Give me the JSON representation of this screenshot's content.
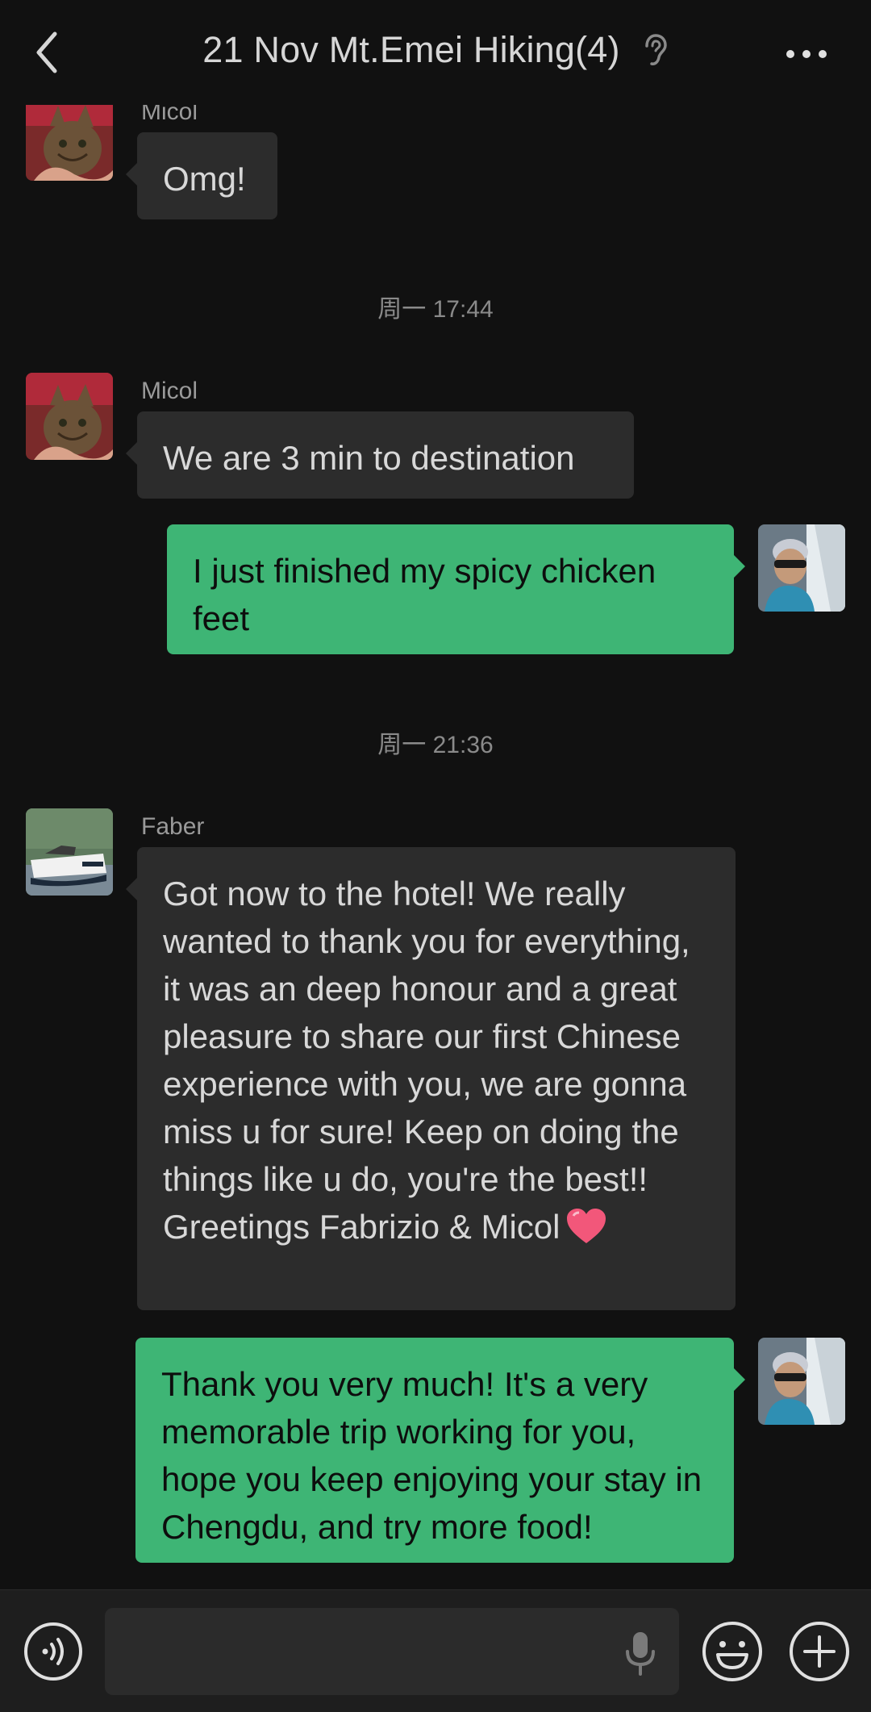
{
  "header": {
    "title": "21 Nov Mt.Emei Hiking(4)",
    "back_icon": "chevron-left-icon",
    "earpiece_icon": "ear-icon",
    "more_icon": "more-dots-icon"
  },
  "messages": [
    {
      "type": "incoming",
      "sender": "Micol",
      "text": "Omg!",
      "avatar": "cat-avatar"
    },
    {
      "type": "timestamp",
      "text": "周一 17:44"
    },
    {
      "type": "incoming",
      "sender": "Micol",
      "text": "We are 3 min to destination",
      "avatar": "cat-avatar"
    },
    {
      "type": "outgoing",
      "text": "I just finished my spicy chicken feet",
      "avatar": "self-avatar"
    },
    {
      "type": "timestamp",
      "text": "周一 21:36"
    },
    {
      "type": "incoming",
      "sender": "Faber",
      "text": "Got now to the hotel! We really wanted to thank you for everything, it was an deep honour and a great pleasure to share our first Chinese experience with you, we are gonna miss u for sure! Keep on doing the things like u do, you're the best!! Greetings Fabrizio & Micol",
      "emoji": "heart",
      "avatar": "boat-avatar"
    },
    {
      "type": "outgoing",
      "text": "Thank you very much! It's a very memorable trip working for you, hope you keep enjoying your stay in Chengdu, and try more food!",
      "avatar": "self-avatar"
    }
  ],
  "input_bar": {
    "text_value": "",
    "voice_icon": "voice-icon",
    "mic_icon": "mic-icon",
    "emoji_icon": "emoji-icon",
    "plus_icon": "plus-icon"
  },
  "colors": {
    "background": "#111111",
    "incoming_bubble": "#2c2c2c",
    "outgoing_bubble": "#3eb575",
    "input_bar": "#1e1e1e"
  }
}
